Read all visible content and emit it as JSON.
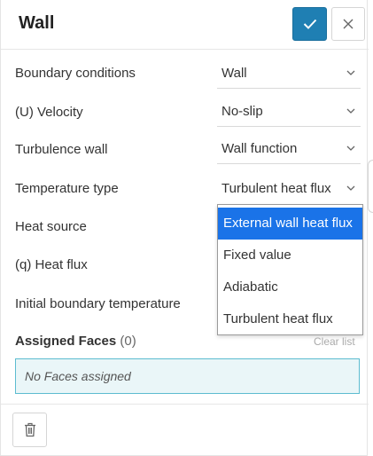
{
  "header": {
    "title": "Wall"
  },
  "fields": [
    {
      "label": "Boundary conditions",
      "value": "Wall"
    },
    {
      "label": "(U) Velocity",
      "value": "No-slip"
    },
    {
      "label": "Turbulence wall",
      "value": "Wall function"
    },
    {
      "label": "Temperature type",
      "value": "Turbulent heat flux"
    },
    {
      "label": "Heat source"
    },
    {
      "label": "(q) Heat flux"
    },
    {
      "label": "Initial boundary temperature"
    }
  ],
  "dropdown": {
    "options": [
      "External wall heat flux",
      "Fixed value",
      "Adiabatic",
      "Turbulent heat flux"
    ],
    "highlighted": "External wall heat flux"
  },
  "assigned": {
    "label": "Assigned Faces",
    "count": "(0)",
    "clear_label": "Clear list",
    "empty_text": "No Faces assigned"
  },
  "colors": {
    "accent": "#1f7fb3",
    "highlight": "#1a73e8",
    "faces_box_bg": "#eaf6f8",
    "faces_box_border": "#5cbcd0"
  },
  "icons": [
    "check-icon",
    "close-icon",
    "chevron-down-icon",
    "trash-icon"
  ]
}
